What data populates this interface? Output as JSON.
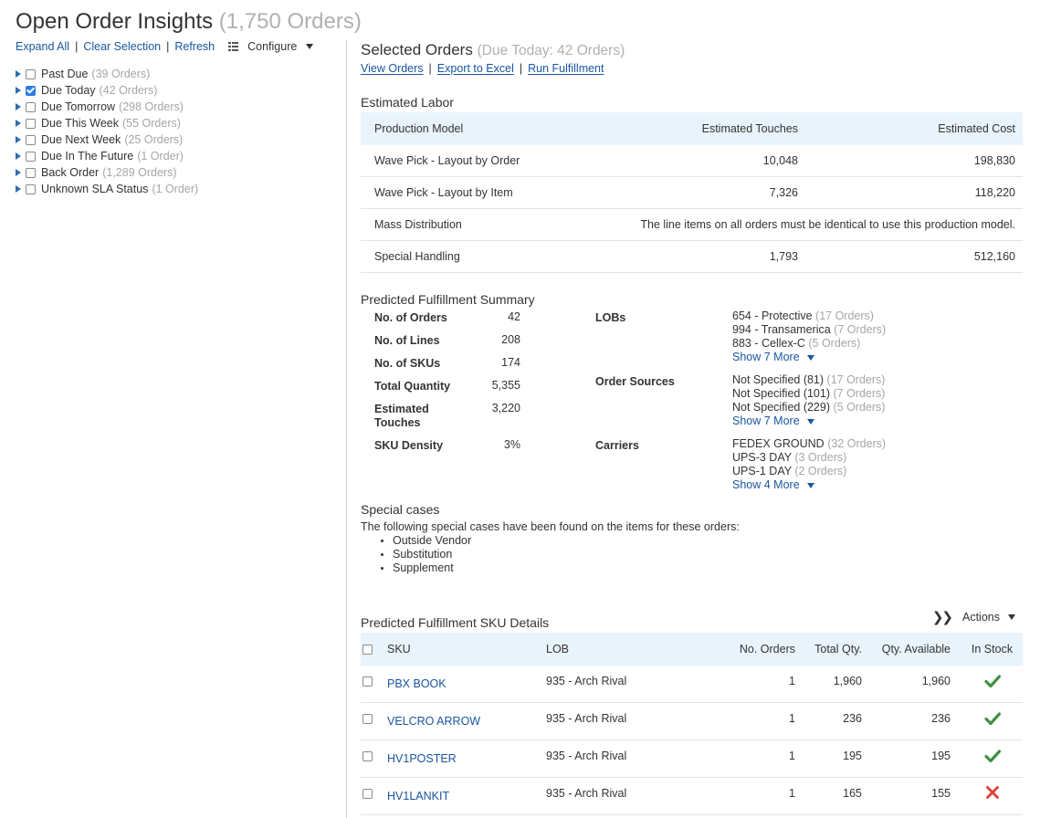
{
  "header": {
    "title": "Open Order Insights",
    "title_count": "(1,750 Orders)",
    "links": [
      "Expand All",
      "Clear Selection",
      "Refresh"
    ],
    "configure_label": "Configure"
  },
  "tree": [
    {
      "label": "Past Due",
      "count": "(39 Orders)",
      "checked": false
    },
    {
      "label": "Due Today",
      "count": "(42 Orders)",
      "checked": true
    },
    {
      "label": "Due Tomorrow",
      "count": "(298 Orders)",
      "checked": false
    },
    {
      "label": "Due This Week",
      "count": "(55 Orders)",
      "checked": false
    },
    {
      "label": "Due Next Week",
      "count": "(25 Orders)",
      "checked": false
    },
    {
      "label": "Due In The Future",
      "count": "(1 Order)",
      "checked": false
    },
    {
      "label": "Back Order",
      "count": "(1,289 Orders)",
      "checked": false
    },
    {
      "label": "Unknown SLA Status",
      "count": "(1 Order)",
      "checked": false
    }
  ],
  "selected": {
    "title": "Selected Orders",
    "subtitle": "(Due Today: 42 Orders)",
    "links": [
      "View Orders",
      "Export to Excel",
      "Run Fulfillment"
    ]
  },
  "labor": {
    "title": "Estimated Labor",
    "headers": [
      "Production Model",
      "Estimated Touches",
      "Estimated Cost"
    ],
    "rows": [
      {
        "model": "Wave Pick - Layout by Order",
        "touches": "10,048",
        "cost": "198,830"
      },
      {
        "model": "Wave Pick - Layout by Item",
        "touches": "7,326",
        "cost": "118,220"
      },
      {
        "model": "Mass Distribution",
        "note": "The line items on all orders must be identical to use this production model."
      },
      {
        "model": "Special Handling",
        "touches": "1,793",
        "cost": "512,160"
      }
    ]
  },
  "summary": {
    "title": "Predicted Fulfillment Summary",
    "stats": [
      {
        "label": "No. of Orders",
        "value": "42"
      },
      {
        "label": "No. of Lines",
        "value": "208"
      },
      {
        "label": "No. of SKUs",
        "value": "174"
      },
      {
        "label": "Total Quantity",
        "value": "5,355"
      },
      {
        "label": "Estimated Touches",
        "value": "3,220"
      },
      {
        "label": "SKU Density",
        "value": "3%"
      }
    ],
    "lobs": {
      "label": "LOBs",
      "items": [
        {
          "name": "654 - Protective",
          "count": "(17 Orders)"
        },
        {
          "name": "994 - Transamerica",
          "count": "(7 Orders)"
        },
        {
          "name": "883 - Cellex-C",
          "count": "(5 Orders)"
        }
      ],
      "more": "Show 7 More"
    },
    "sources": {
      "label": "Order Sources",
      "items": [
        {
          "name": "Not Specified (81)",
          "count": "(17 Orders)"
        },
        {
          "name": "Not Specified (101)",
          "count": "(7 Orders)"
        },
        {
          "name": "Not Specified (229)",
          "count": "(5 Orders)"
        }
      ],
      "more": "Show 7 More"
    },
    "carriers": {
      "label": "Carriers",
      "items": [
        {
          "name": "FEDEX GROUND",
          "count": "(32 Orders)"
        },
        {
          "name": "UPS-3 DAY",
          "count": "(3 Orders)"
        },
        {
          "name": "UPS-1 DAY",
          "count": "(2 Orders)"
        }
      ],
      "more": "Show 4 More"
    }
  },
  "special": {
    "title": "Special cases",
    "description": "The following special cases have been found on the items for these orders:",
    "items": [
      "Outside Vendor",
      "Substitution",
      "Supplement"
    ]
  },
  "sku_details": {
    "title": "Predicted Fulfillment SKU Details",
    "actions_label": "Actions",
    "headers": [
      "SKU",
      "LOB",
      "No. Orders",
      "Total Qty.",
      "Qty. Available",
      "In Stock"
    ],
    "rows": [
      {
        "sku": "PBX BOOK",
        "lob": "935 - Arch Rival",
        "orders": "1",
        "total": "1,960",
        "available": "1,960",
        "in_stock": true
      },
      {
        "sku": "VELCRO ARROW",
        "lob": "935 - Arch Rival",
        "orders": "1",
        "total": "236",
        "available": "236",
        "in_stock": true
      },
      {
        "sku": "HV1POSTER",
        "lob": "935 - Arch Rival",
        "orders": "1",
        "total": "195",
        "available": "195",
        "in_stock": true
      },
      {
        "sku": "HV1LANKIT",
        "lob": "935 - Arch Rival",
        "orders": "1",
        "total": "165",
        "available": "155",
        "in_stock": false
      }
    ]
  },
  "colors": {
    "link": "#1a56a0",
    "header_bg": "#e9f3fc",
    "in_stock": "#3f9142",
    "out_of_stock": "#d9463e",
    "checkbox_checked": "#2f7be5"
  }
}
